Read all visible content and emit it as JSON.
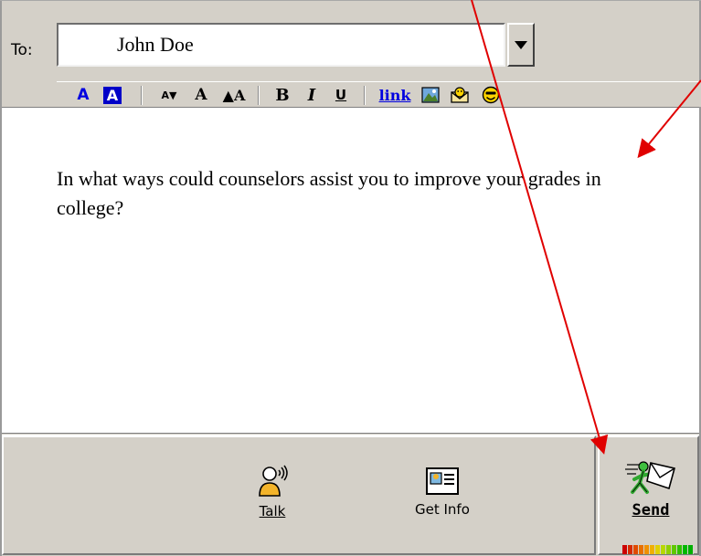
{
  "to": {
    "label": "To:",
    "value": "John Doe"
  },
  "toolbar": {
    "buttons": [
      {
        "name": "text-color",
        "glyph": "A"
      },
      {
        "name": "background-color",
        "glyph": "A"
      },
      {
        "name": "decrease-font-size",
        "glyph": "A▼"
      },
      {
        "name": "normal-font-size",
        "glyph": "A"
      },
      {
        "name": "increase-font-size",
        "glyph": "▲A"
      },
      {
        "name": "bold",
        "glyph": "B"
      },
      {
        "name": "italic",
        "glyph": "I"
      },
      {
        "name": "underline",
        "glyph": "U"
      },
      {
        "name": "insert-link",
        "glyph": "link"
      },
      {
        "name": "insert-picture",
        "glyph": ""
      },
      {
        "name": "send-email",
        "glyph": ""
      },
      {
        "name": "insert-smiley",
        "glyph": ""
      }
    ]
  },
  "message": {
    "text": "In what ways could counselors assist you to improve your grades in college?"
  },
  "actions": {
    "talk_label": "Talk",
    "get_info_label": "Get Info",
    "send_label": "Send"
  },
  "warning_meter": {
    "level": 1.0,
    "colors": [
      "#cc0000",
      "#d62a00",
      "#e04a00",
      "#e87000",
      "#f09000",
      "#f0b000",
      "#e0d000",
      "#b8d800",
      "#90d000",
      "#60c800",
      "#30c000",
      "#00b800",
      "#00b000"
    ]
  },
  "colors": {
    "annotation_arrow": "#e00000",
    "toolbar_blue": "#0000e0"
  }
}
